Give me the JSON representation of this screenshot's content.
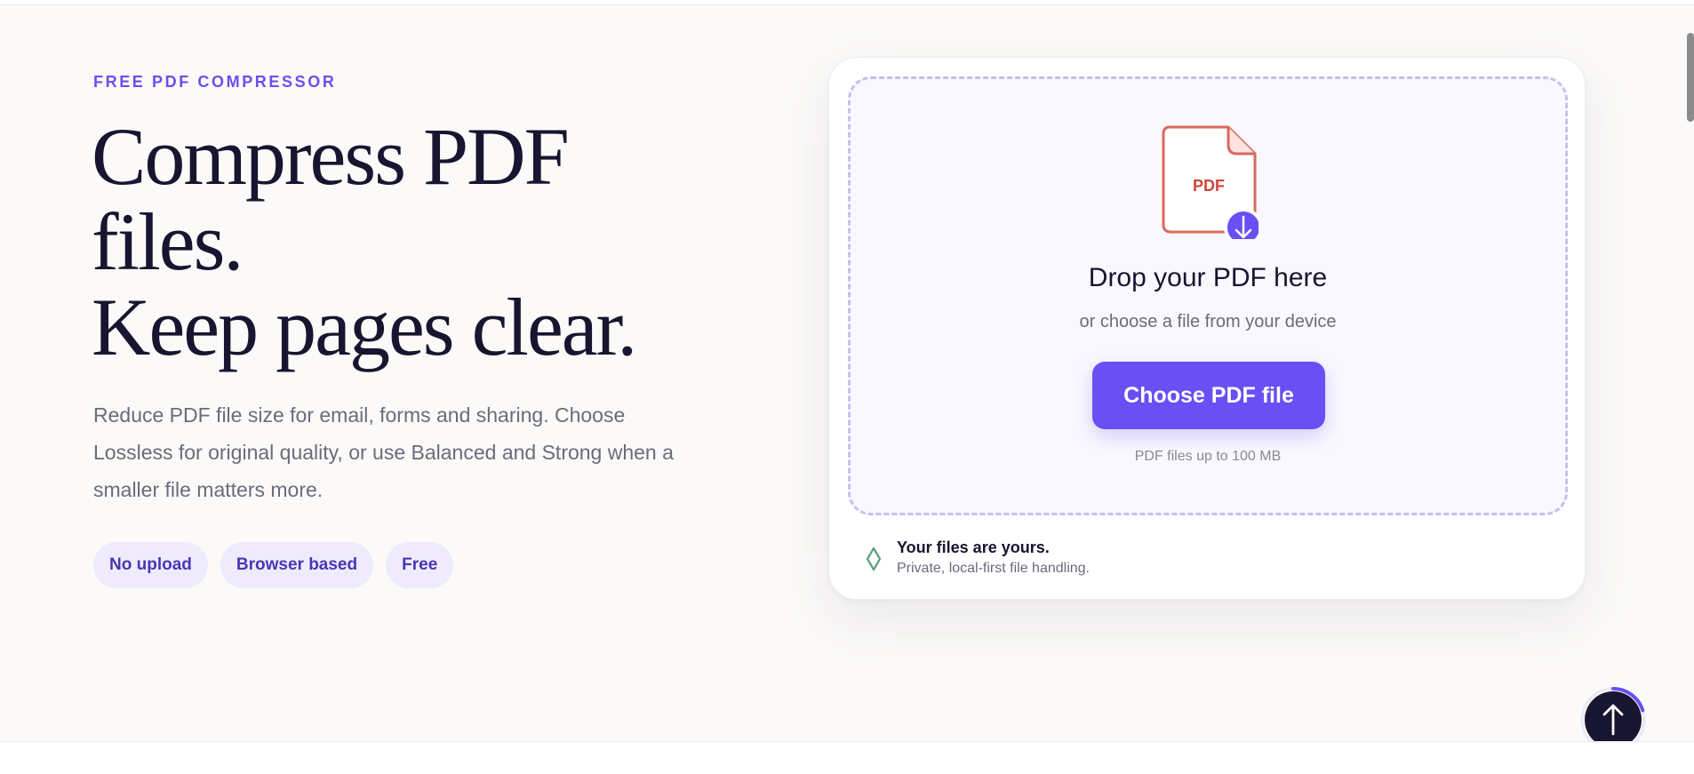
{
  "hero": {
    "eyebrow": "FREE PDF COMPRESSOR",
    "title_line1": "Compress PDF",
    "title_line2": "files.",
    "title_line3": "Keep pages clear.",
    "description": "Reduce PDF file size for email, forms and sharing. Choose Lossless for original quality, or use Balanced and Strong when a smaller file matters more.",
    "chips": [
      "No upload",
      "Browser based",
      "Free"
    ]
  },
  "upload": {
    "icon_label": "PDF",
    "drop_title": "Drop your PDF here",
    "drop_subtitle": "or choose a file from your device",
    "choose_button": "Choose PDF file",
    "limit_note": "PDF files up to 100 MB",
    "privacy_title": "Your files are yours.",
    "privacy_subtitle": "Private, local-first file handling."
  },
  "icons": {
    "pdf": "pdf-file-icon",
    "download": "arrow-down-icon",
    "privacy": "diamond-icon",
    "back_to_top": "arrow-up-icon"
  },
  "colors": {
    "accent": "#6a4ff4",
    "accent_text": "#4b35b5",
    "chip_bg": "#efebfd",
    "heading": "#17152f",
    "body_text": "#6d6a7a",
    "pdf_red": "#d9695c",
    "privacy_green": "#5a9b7a",
    "dark_button": "#17152f"
  },
  "scroll_progress": 0.2
}
